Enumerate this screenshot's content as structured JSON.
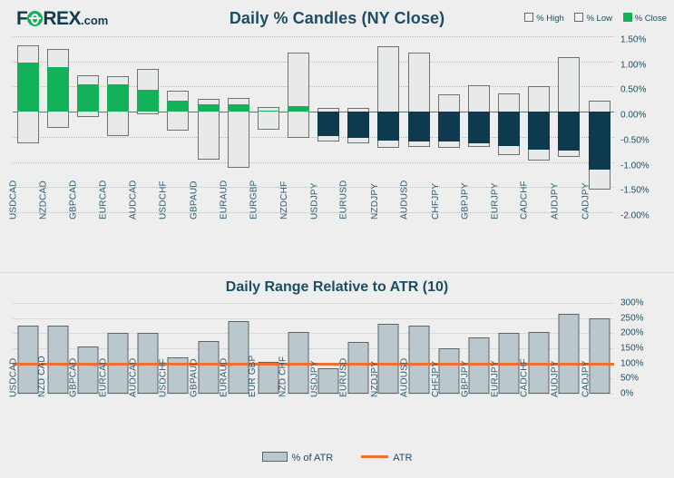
{
  "brand": {
    "name_part1": "F",
    "name_part2": "REX",
    "suffix": ".com"
  },
  "header": {
    "title": "Daily % Candles (NY Close)",
    "legend": [
      {
        "label": "% High",
        "type": "outline",
        "color": "#f0f0f0"
      },
      {
        "label": "% Low",
        "type": "outline",
        "color": "#f0f0f0"
      },
      {
        "label": "% Close",
        "type": "filled",
        "color": "#13b25a"
      }
    ]
  },
  "chart2_header": {
    "title": "Daily Range Relative to ATR (10)",
    "legend": [
      {
        "label": "% of ATR",
        "type": "bar",
        "color": "#bac7cd"
      },
      {
        "label": "ATR",
        "type": "line",
        "color": "#ef7030"
      }
    ]
  },
  "chart_data": [
    {
      "type": "bar",
      "title": "Daily % Candles (NY Close)",
      "xlabel": "",
      "ylabel": "",
      "ylim": [
        -2.0,
        1.5
      ],
      "yticks": [
        1.5,
        1.0,
        0.5,
        0.0,
        -0.5,
        -1.0,
        -1.5,
        -2.0
      ],
      "ytick_labels": [
        "1.50%",
        "1.00%",
        "0.50%",
        "0.00%",
        "-0.50%",
        "-1.00%",
        "-1.50%",
        "-2.00%"
      ],
      "grid": true,
      "legend_position": "top-right",
      "categories": [
        "USDCAD",
        "NZDCAD",
        "GBPCAD",
        "EURCAD",
        "AUDCAD",
        "USDCHF",
        "GBPAUD",
        "EURAUD",
        "EURGBP",
        "NZDCHF",
        "USDJPY",
        "EURUSD",
        "NZDJPY",
        "AUDUSD",
        "CHFJPY",
        "GBPJPY",
        "EURJPY",
        "CADCHF",
        "AUDJPY",
        "CADJPY"
      ],
      "series": [
        {
          "name": "% High",
          "values": [
            1.32,
            1.25,
            0.72,
            0.7,
            0.85,
            0.42,
            0.25,
            0.28,
            0.1,
            1.17,
            0.08,
            0.08,
            1.3,
            1.18,
            0.35,
            0.52,
            0.36,
            0.5,
            1.08,
            0.22
          ]
        },
        {
          "name": "% Low",
          "values": [
            -0.62,
            -0.32,
            -0.1,
            -0.48,
            -0.05,
            -0.38,
            -0.95,
            -1.12,
            -0.35,
            -0.52,
            -0.6,
            -0.62,
            -0.72,
            -0.7,
            -0.72,
            -0.7,
            -0.86,
            -0.98,
            -0.9,
            -1.55
          ]
        },
        {
          "name": "% Close",
          "values": [
            0.98,
            0.88,
            0.55,
            0.54,
            0.44,
            0.22,
            0.14,
            0.15,
            0.02,
            0.11,
            -0.48,
            -0.52,
            -0.58,
            -0.6,
            -0.6,
            -0.62,
            -0.68,
            -0.76,
            -0.78,
            -1.15
          ]
        }
      ]
    },
    {
      "type": "bar",
      "title": "Daily Range Relative to ATR (10)",
      "xlabel": "",
      "ylabel": "",
      "ylim": [
        0,
        300
      ],
      "yticks": [
        300,
        250,
        200,
        150,
        100,
        50,
        0
      ],
      "ytick_labels": [
        "300%",
        "250%",
        "200%",
        "150%",
        "100%",
        "50%",
        "0%"
      ],
      "grid": true,
      "legend_position": "bottom-center",
      "categories": [
        "USDCAD",
        "NZD CAD",
        "GBPCAD",
        "EURCAD",
        "AUDCAD",
        "USDCHF",
        "GBPAUD",
        "EURAUD",
        "EUR GBP",
        "NZD CHF",
        "USDJPY",
        "EURUSD",
        "NZDJPY",
        "AUDUSD",
        "CHFJPY",
        "GBPJPY",
        "EURJPY",
        "CADCHF",
        "AUDJPY",
        "CADJPY"
      ],
      "series": [
        {
          "name": "% of ATR",
          "values": [
            225,
            225,
            155,
            200,
            200,
            120,
            175,
            240,
            105,
            205,
            85,
            170,
            232,
            225,
            150,
            185,
            200,
            205,
            265,
            250
          ]
        }
      ],
      "reference_line": {
        "name": "ATR",
        "value": 100,
        "color": "#ef7030"
      }
    }
  ]
}
